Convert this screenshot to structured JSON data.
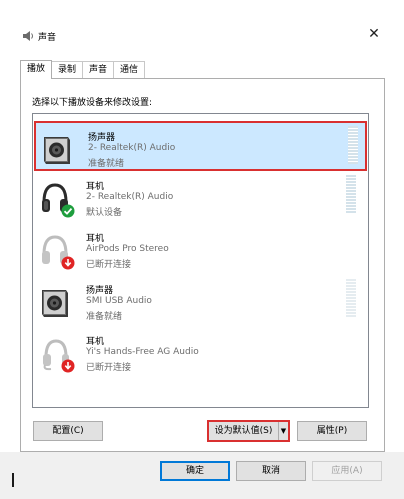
{
  "window": {
    "title": "声音",
    "close_glyph": "✕"
  },
  "tabs": [
    {
      "label": "播放",
      "active": true
    },
    {
      "label": "录制",
      "active": false
    },
    {
      "label": "声音",
      "active": false
    },
    {
      "label": "通信",
      "active": false
    }
  ],
  "instruction": "选择以下播放设备来修改设置:",
  "devices": [
    {
      "name": "扬声器",
      "desc": "2- Realtek(R) Audio",
      "status": "准备就绪",
      "icon": "speaker-icon",
      "badge": "",
      "selected": true
    },
    {
      "name": "耳机",
      "desc": "2- Realtek(R) Audio",
      "status": "默认设备",
      "icon": "headphones-icon",
      "badge": "default-check",
      "selected": false
    },
    {
      "name": "耳机",
      "desc": "AirPods Pro Stereo",
      "status": "已断开连接",
      "icon": "headphones-icon",
      "badge": "disconnected-arrow",
      "selected": false
    },
    {
      "name": "扬声器",
      "desc": "SMI USB Audio",
      "status": "准备就绪",
      "icon": "speaker-icon",
      "badge": "",
      "selected": false
    },
    {
      "name": "耳机",
      "desc": "Yi's Hands-Free AG Audio",
      "status": "已断开连接",
      "icon": "headset-icon",
      "badge": "disconnected-arrow",
      "selected": false
    }
  ],
  "buttons": {
    "configure": "配置(C)",
    "set_default": "设为默认值(S)",
    "properties": "属性(P)",
    "ok": "确定",
    "cancel": "取消",
    "apply": "应用(A)"
  },
  "colors": {
    "accent": "#0078d7",
    "highlight": "#d93030",
    "selection": "#cce8ff",
    "default_badge": "#1e9e3e",
    "disconnected_badge": "#e02424"
  }
}
